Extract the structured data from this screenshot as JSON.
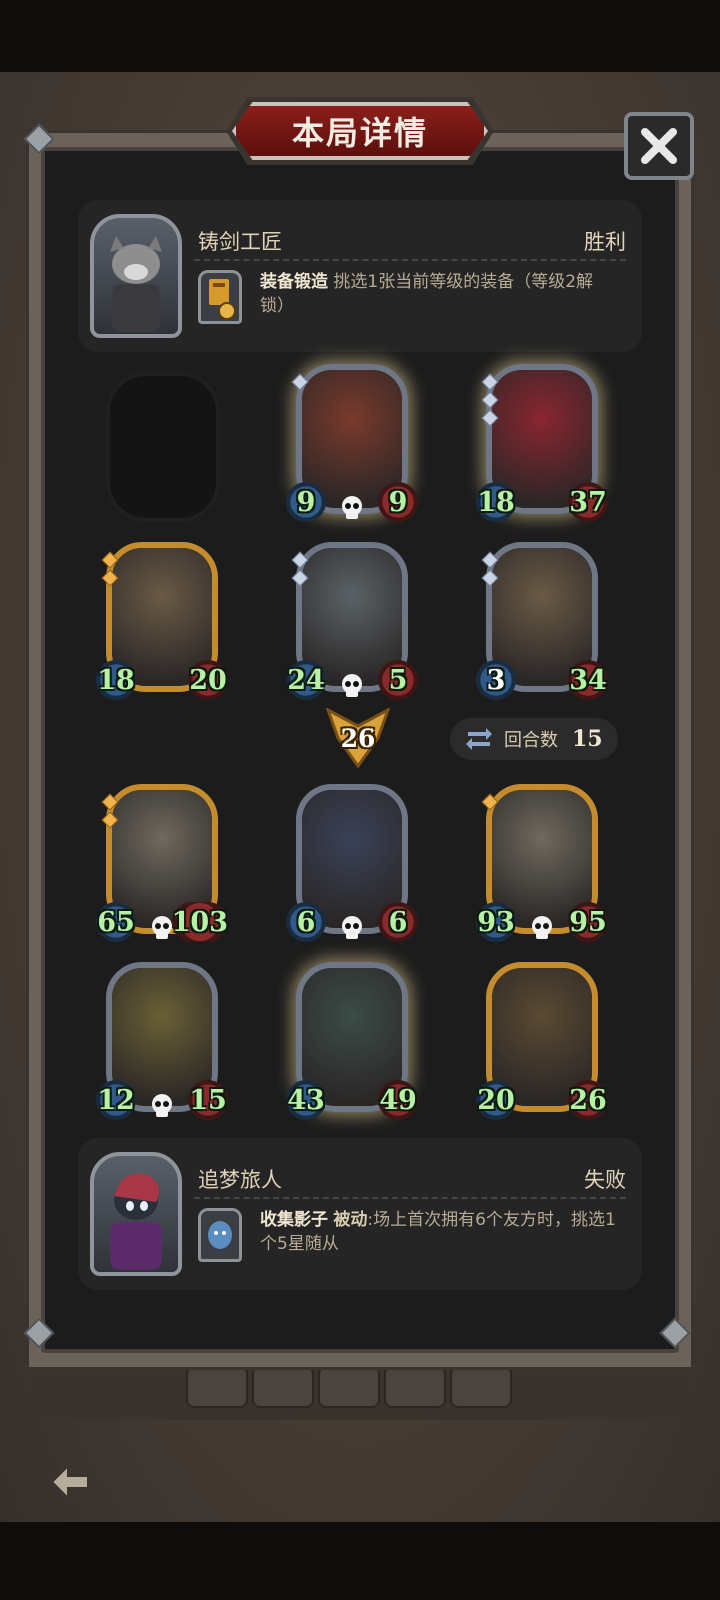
{
  "title": "本局详情",
  "close_icon": "close-icon",
  "player_top": {
    "name": "铸剑工匠",
    "result": "胜利",
    "skill_name": "装备锻造",
    "skill_desc": "挑选1张当前等级的装备（等级2解锁）",
    "item_level": "2"
  },
  "player_bottom": {
    "name": "追梦旅人",
    "result": "失败",
    "skill_name": "收集影子",
    "skill_tag": "被动",
    "skill_desc": ":场上首次拥有6个友方时，挑选1个5星随从"
  },
  "top_board": [
    {
      "attack": "9",
      "health": "9",
      "frame": "silver",
      "glow": true,
      "gems": 1,
      "gem_color": "silver",
      "skull": true,
      "art": "#7a3a2c"
    },
    {
      "attack": "18",
      "health": "37",
      "frame": "silver",
      "glow": true,
      "gems": 3,
      "gem_color": "silver",
      "skull": false,
      "art": "#8a2630"
    },
    {
      "attack": "18",
      "health": "20",
      "frame": "gold",
      "glow": false,
      "gems": 2,
      "gem_color": "gold",
      "skull": false,
      "art": "#6a5a46"
    },
    {
      "attack": "24",
      "health": "5",
      "frame": "silver",
      "glow": false,
      "gems": 2,
      "gem_color": "silver",
      "skull": true,
      "art": "#5a6266"
    },
    {
      "attack": "3",
      "health": "34",
      "frame": "silver",
      "glow": false,
      "gems": 2,
      "gem_color": "silver",
      "skull": false,
      "art": "#6a5a46",
      "attack_white": true
    }
  ],
  "bottom_board": [
    {
      "attack": "65",
      "health": "103",
      "frame": "gold",
      "glow": false,
      "gems": 2,
      "gem_color": "gold",
      "skull": true,
      "art": "#6e6a5e"
    },
    {
      "attack": "6",
      "health": "6",
      "frame": "silver",
      "glow": false,
      "gems": 0,
      "gem_color": "silver",
      "skull": true,
      "art": "#3a4258"
    },
    {
      "attack": "93",
      "health": "95",
      "frame": "gold",
      "glow": false,
      "gems": 1,
      "gem_color": "gold",
      "skull": true,
      "art": "#6e6a5e"
    },
    {
      "attack": "12",
      "health": "15",
      "frame": "silver",
      "glow": false,
      "gems": 0,
      "gem_color": "silver",
      "skull": true,
      "art": "#6a6036"
    },
    {
      "attack": "43",
      "health": "49",
      "frame": "silver",
      "glow": true,
      "gems": 0,
      "gem_color": "silver",
      "skull": false,
      "art": "#3c4c48"
    },
    {
      "attack": "20",
      "health": "26",
      "frame": "gold",
      "glow": false,
      "gems": 0,
      "gem_color": "gold",
      "skull": false,
      "art": "#5a4a32"
    }
  ],
  "damage": "26",
  "turns": {
    "label": "回合数",
    "value": "15",
    "icon": "swap-arrows-icon"
  },
  "back_icon": "back-arrow-icon"
}
